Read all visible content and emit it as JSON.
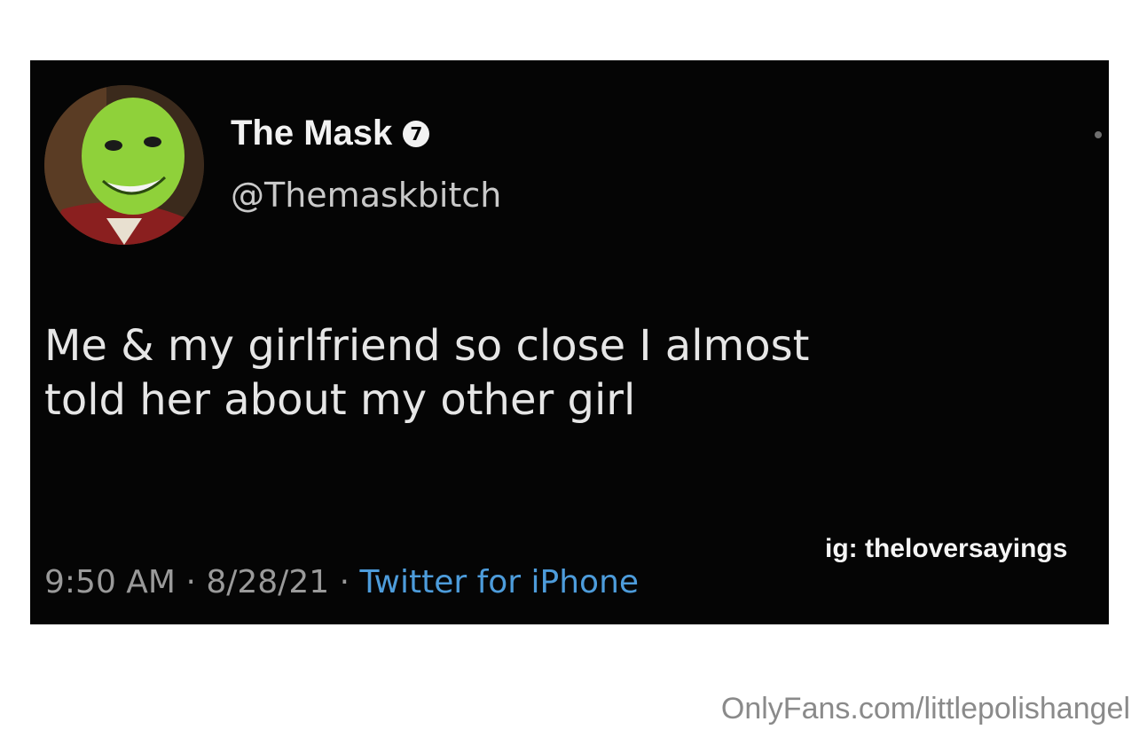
{
  "tweet": {
    "display_name": "The Mask",
    "verified_badge": "7",
    "handle": "@Themaskbitch",
    "text_lines": [
      "Me & my girlfriend so close I almost",
      "told her about my other girl"
    ],
    "time": "9:50 AM",
    "separator": "·",
    "date": "8/28/21",
    "source": "Twitter for iPhone"
  },
  "ig_tag": "ig: theloversayings",
  "watermark": "OnlyFans.com/littlepolishangel",
  "icons": {
    "avatar": "green-mask-face-avatar",
    "verified": "verified-badge-icon",
    "more": "more-dot-icon"
  },
  "colors": {
    "card_background": "#050505",
    "source_link": "#4d9cdb",
    "avatar_face": "#8fd13a"
  }
}
